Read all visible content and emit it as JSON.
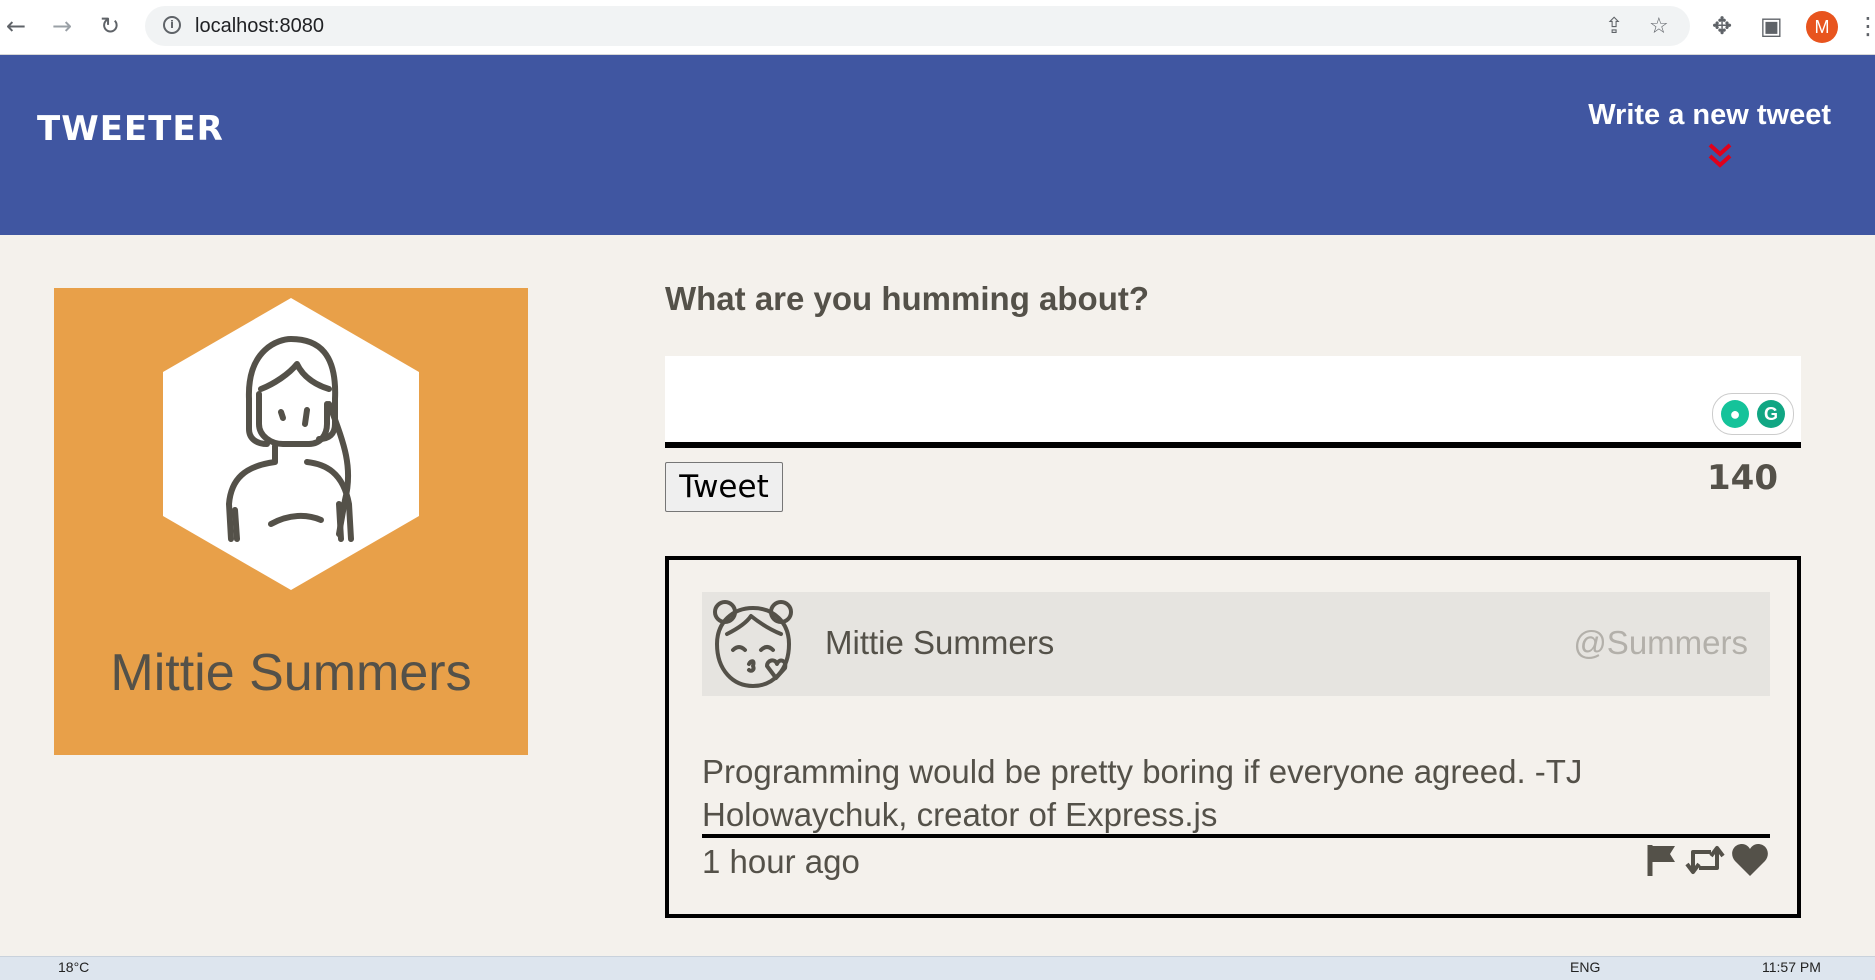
{
  "browser": {
    "url": "localhost:8080",
    "profile_initial": "M",
    "icons": [
      "back-arrow-icon",
      "forward-arrow-icon",
      "reload-icon",
      "info-icon",
      "share-icon",
      "star-icon",
      "extensions-icon",
      "side-panel-icon",
      "menu-icon"
    ]
  },
  "header": {
    "brand": "TWEETER",
    "write_label": "Write a new tweet",
    "accent": "#4056a1",
    "chevron_color": "#e0001b"
  },
  "profile": {
    "name": "Mittie Summers",
    "card_color": "#e8a049"
  },
  "compose": {
    "prompt": "What are you humming about?",
    "text_value": "",
    "button_label": "Tweet",
    "counter": "140"
  },
  "tweet": {
    "name": "Mittie Summers",
    "handle": "@Summers",
    "body": "Programming would be pretty boring if everyone agreed. -TJ Holowaychuk, creator of Express.js",
    "time": "1 hour ago",
    "actions": [
      "flag-icon",
      "retweet-icon",
      "heart-icon"
    ]
  },
  "taskbar": {
    "weather": "18°C",
    "language": "ENG",
    "clock": "11:57 PM"
  }
}
